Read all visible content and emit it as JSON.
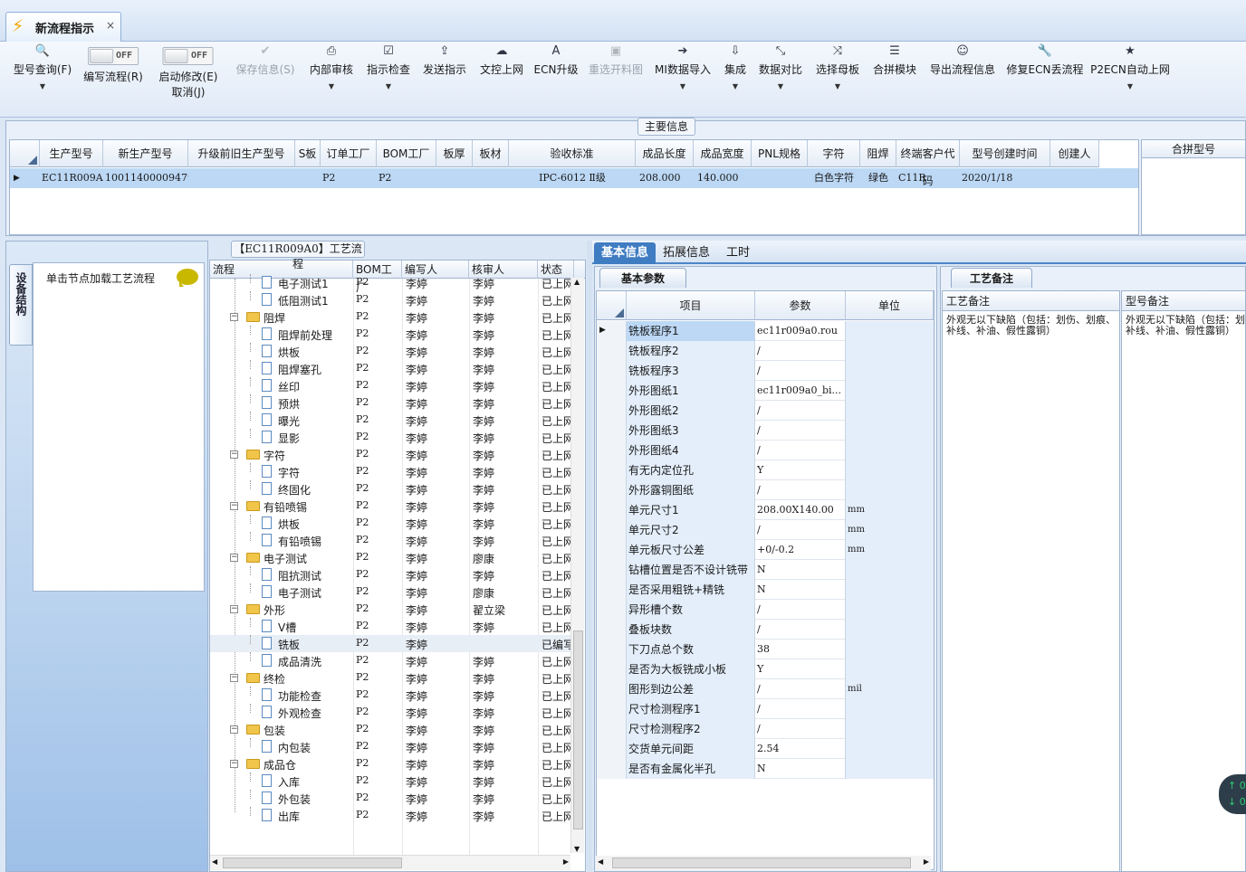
{
  "window": {
    "tab_title": "新流程指示",
    "close": "×"
  },
  "toolbar": {
    "items": [
      {
        "id": "model-query",
        "label": "型号查询(F)",
        "icon": "search-icon",
        "dropdown": true,
        "enabled": true
      },
      {
        "id": "write-flow",
        "label": "编写流程(R)",
        "toggle": "OFF",
        "enabled": true
      },
      {
        "id": "start-modify",
        "label": "启动修改(E)",
        "label2": "取消(J)",
        "toggle": "OFF",
        "enabled": true
      },
      {
        "id": "save-info",
        "label": "保存信息(S)",
        "icon": "check-icon",
        "enabled": false
      },
      {
        "id": "internal-review",
        "label": "内部审核",
        "icon": "printer-icon",
        "dropdown": true,
        "enabled": true
      },
      {
        "id": "instruction-check",
        "label": "指示检查",
        "icon": "checkbox-icon",
        "dropdown": true,
        "enabled": true
      },
      {
        "id": "send-instruction",
        "label": "发送指示",
        "icon": "upload-icon",
        "enabled": true
      },
      {
        "id": "doc-control-upload",
        "label": "文控上网",
        "icon": "cloud-upload-icon",
        "enabled": true
      },
      {
        "id": "ecn-upgrade",
        "label": "ECN升级",
        "icon": "font-icon",
        "enabled": true
      },
      {
        "id": "reselect-drawing",
        "label": "重选开料图",
        "icon": "image-icon",
        "enabled": false
      },
      {
        "id": "mi-import",
        "label": "MI数据导入",
        "icon": "sign-in-icon",
        "dropdown": true,
        "enabled": true
      },
      {
        "id": "integrate",
        "label": "集成",
        "icon": "download-icon",
        "dropdown": true,
        "enabled": true
      },
      {
        "id": "data-compare",
        "label": "数据对比",
        "icon": "compress-icon",
        "dropdown": true,
        "enabled": true
      },
      {
        "id": "select-master",
        "label": "选择母板",
        "icon": "random-icon",
        "dropdown": true,
        "enabled": true
      },
      {
        "id": "merge-module",
        "label": "合拼模块",
        "icon": "list-icon",
        "enabled": true
      },
      {
        "id": "export-flow",
        "label": "导出流程信息",
        "icon": "smile-icon",
        "enabled": true
      },
      {
        "id": "fix-ecn",
        "label": "修复ECN丢流程",
        "icon": "wrench-icon",
        "enabled": true
      },
      {
        "id": "p2ecn-upload",
        "label": "P2ECN自动上网",
        "icon": "star-icon",
        "dropdown": true,
        "enabled": true
      }
    ]
  },
  "main_info": {
    "legend": "主要信息",
    "columns": [
      "生产型号",
      "新生产型号",
      "升级前旧生产型号",
      "S板",
      "订单工厂",
      "BOM工厂",
      "板厚",
      "板材",
      "验收标准",
      "成品长度",
      "成品宽度",
      "PNL规格",
      "字符",
      "阻焊",
      "终端客户代码",
      "型号创建时间",
      "创建人"
    ],
    "row": [
      "EC11R009A0",
      "10011400009479",
      "",
      "",
      "P2",
      "P2",
      "",
      "",
      "IPC-6012 Ⅱ级",
      "208.000",
      "140.000",
      "",
      "白色字符",
      "绿色",
      "C11R",
      "2020/1/18",
      ""
    ],
    "merge_header": "合拼型号"
  },
  "left": {
    "vtab": "设备结构",
    "hint": "单击节点加载工艺流程"
  },
  "process_tree": {
    "legend": "【EC11R009A0】工艺流程",
    "columns": [
      "流程",
      "BOM工厂",
      "编写人",
      "核审人",
      "状态"
    ],
    "rows": [
      {
        "name": "电子测试1",
        "level": 1,
        "type": "leaf",
        "bom": "P2",
        "writer": "李婷",
        "reviewer": "李婷",
        "status": "已上网"
      },
      {
        "name": "低阻测试1",
        "level": 1,
        "type": "leaf",
        "bom": "P2",
        "writer": "李婷",
        "reviewer": "李婷",
        "status": "已上网"
      },
      {
        "name": "阻焊",
        "level": 0,
        "type": "folder",
        "bom": "P2",
        "writer": "李婷",
        "reviewer": "李婷",
        "status": "已上网"
      },
      {
        "name": "阻焊前处理",
        "level": 1,
        "type": "leaf",
        "bom": "P2",
        "writer": "李婷",
        "reviewer": "李婷",
        "status": "已上网"
      },
      {
        "name": "烘板",
        "level": 1,
        "type": "leaf",
        "bom": "P2",
        "writer": "李婷",
        "reviewer": "李婷",
        "status": "已上网"
      },
      {
        "name": "阻焊塞孔",
        "level": 1,
        "type": "leaf",
        "bom": "P2",
        "writer": "李婷",
        "reviewer": "李婷",
        "status": "已上网"
      },
      {
        "name": "丝印",
        "level": 1,
        "type": "leaf",
        "bom": "P2",
        "writer": "李婷",
        "reviewer": "李婷",
        "status": "已上网"
      },
      {
        "name": "预烘",
        "level": 1,
        "type": "leaf",
        "bom": "P2",
        "writer": "李婷",
        "reviewer": "李婷",
        "status": "已上网"
      },
      {
        "name": "曝光",
        "level": 1,
        "type": "leaf",
        "bom": "P2",
        "writer": "李婷",
        "reviewer": "李婷",
        "status": "已上网"
      },
      {
        "name": "显影",
        "level": 1,
        "type": "leaf",
        "bom": "P2",
        "writer": "李婷",
        "reviewer": "李婷",
        "status": "已上网"
      },
      {
        "name": "字符",
        "level": 0,
        "type": "folder",
        "bom": "P2",
        "writer": "李婷",
        "reviewer": "李婷",
        "status": "已上网"
      },
      {
        "name": "字符",
        "level": 1,
        "type": "leaf",
        "bom": "P2",
        "writer": "李婷",
        "reviewer": "李婷",
        "status": "已上网"
      },
      {
        "name": "终固化",
        "level": 1,
        "type": "leaf",
        "bom": "P2",
        "writer": "李婷",
        "reviewer": "李婷",
        "status": "已上网"
      },
      {
        "name": "有铅喷锡",
        "level": 0,
        "type": "folder",
        "bom": "P2",
        "writer": "李婷",
        "reviewer": "李婷",
        "status": "已上网"
      },
      {
        "name": "烘板",
        "level": 1,
        "type": "leaf",
        "bom": "P2",
        "writer": "李婷",
        "reviewer": "李婷",
        "status": "已上网"
      },
      {
        "name": "有铅喷锡",
        "level": 1,
        "type": "leaf",
        "bom": "P2",
        "writer": "李婷",
        "reviewer": "李婷",
        "status": "已上网"
      },
      {
        "name": "电子测试",
        "level": 0,
        "type": "folder",
        "bom": "P2",
        "writer": "李婷",
        "reviewer": "廖康",
        "status": "已上网"
      },
      {
        "name": "阻抗测试",
        "level": 1,
        "type": "leaf",
        "bom": "P2",
        "writer": "李婷",
        "reviewer": "李婷",
        "status": "已上网"
      },
      {
        "name": "电子测试",
        "level": 1,
        "type": "leaf",
        "bom": "P2",
        "writer": "李婷",
        "reviewer": "廖康",
        "status": "已上网"
      },
      {
        "name": "外形",
        "level": 0,
        "type": "folder",
        "bom": "P2",
        "writer": "李婷",
        "reviewer": "翟立梁",
        "status": "已上网"
      },
      {
        "name": "V槽",
        "level": 1,
        "type": "leaf",
        "bom": "P2",
        "writer": "李婷",
        "reviewer": "李婷",
        "status": "已上网"
      },
      {
        "name": "铣板",
        "level": 1,
        "type": "leaf",
        "bom": "P2",
        "writer": "李婷",
        "reviewer": "",
        "status": "已编写",
        "selected": true
      },
      {
        "name": "成品清洗",
        "level": 1,
        "type": "leaf",
        "bom": "P2",
        "writer": "李婷",
        "reviewer": "李婷",
        "status": "已上网"
      },
      {
        "name": "终检",
        "level": 0,
        "type": "folder",
        "bom": "P2",
        "writer": "李婷",
        "reviewer": "李婷",
        "status": "已上网"
      },
      {
        "name": "功能检查",
        "level": 1,
        "type": "leaf",
        "bom": "P2",
        "writer": "李婷",
        "reviewer": "李婷",
        "status": "已上网"
      },
      {
        "name": "外观检查",
        "level": 1,
        "type": "leaf",
        "bom": "P2",
        "writer": "李婷",
        "reviewer": "李婷",
        "status": "已上网"
      },
      {
        "name": "包装",
        "level": 0,
        "type": "folder",
        "bom": "P2",
        "writer": "李婷",
        "reviewer": "李婷",
        "status": "已上网"
      },
      {
        "name": "内包装",
        "level": 1,
        "type": "leaf",
        "bom": "P2",
        "writer": "李婷",
        "reviewer": "李婷",
        "status": "已上网"
      },
      {
        "name": "成品仓",
        "level": 0,
        "type": "folder",
        "bom": "P2",
        "writer": "李婷",
        "reviewer": "李婷",
        "status": "已上网"
      },
      {
        "name": "入库",
        "level": 1,
        "type": "leaf",
        "bom": "P2",
        "writer": "李婷",
        "reviewer": "李婷",
        "status": "已上网"
      },
      {
        "name": "外包装",
        "level": 1,
        "type": "leaf",
        "bom": "P2",
        "writer": "李婷",
        "reviewer": "李婷",
        "status": "已上网"
      },
      {
        "name": "出库",
        "level": 1,
        "type": "leaf",
        "bom": "P2",
        "writer": "李婷",
        "reviewer": "李婷",
        "status": "已上网"
      }
    ]
  },
  "right_tabs": {
    "basic": "基本信息",
    "extended": "拓展信息",
    "hours": "工时"
  },
  "basic_params": {
    "tab": "基本参数",
    "columns": [
      "项目",
      "参数",
      "单位"
    ],
    "rows": [
      [
        "铣板程序1",
        "ec11r009a0.rou",
        ""
      ],
      [
        "铣板程序2",
        "/",
        ""
      ],
      [
        "铣板程序3",
        "/",
        ""
      ],
      [
        "外形图纸1",
        "ec11r009a0_bi...",
        ""
      ],
      [
        "外形图纸2",
        "/",
        ""
      ],
      [
        "外形图纸3",
        "/",
        ""
      ],
      [
        "外形图纸4",
        "/",
        ""
      ],
      [
        "有无内定位孔",
        "Y",
        ""
      ],
      [
        "外形露铜图纸",
        "/",
        ""
      ],
      [
        "单元尺寸1",
        "208.00X140.00",
        "mm"
      ],
      [
        "单元尺寸2",
        "/",
        "mm"
      ],
      [
        "单元板尺寸公差",
        "+0/-0.2",
        "mm"
      ],
      [
        "钻槽位置是否不设计铣带",
        "N",
        ""
      ],
      [
        "是否采用粗铣+精铣",
        "N",
        ""
      ],
      [
        "异形槽个数",
        "/",
        ""
      ],
      [
        "叠板块数",
        "/",
        ""
      ],
      [
        "下刀点总个数",
        "38",
        ""
      ],
      [
        "是否为大板铣成小板",
        "Y",
        ""
      ],
      [
        "图形到边公差",
        "/",
        "mil"
      ],
      [
        "尺寸检测程序1",
        "/",
        ""
      ],
      [
        "尺寸检测程序2",
        "/",
        ""
      ],
      [
        "交货单元间距",
        "2.54",
        ""
      ],
      [
        "是否有金属化半孔",
        "N",
        ""
      ]
    ]
  },
  "remarks": {
    "tab": "工艺备注",
    "process_header": "工艺备注",
    "process_text": "外观无以下缺陷（包括：划伤、划痕、补线、补油、假性露铜）",
    "model_header": "型号备注",
    "model_text": "外观无以下缺陷（包括：划伤、划痕、补线、补油、假性露铜）"
  },
  "float_widget": {
    "up": "0",
    "down": "0"
  }
}
